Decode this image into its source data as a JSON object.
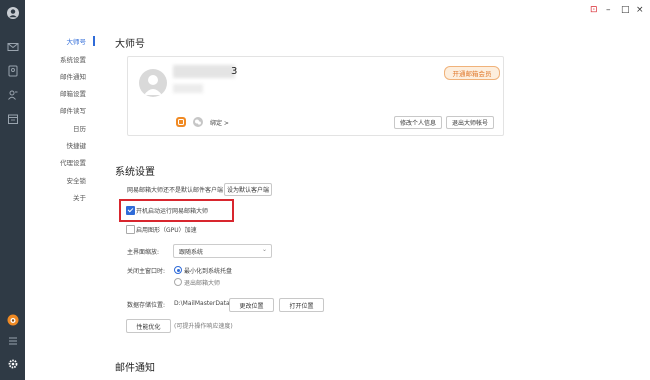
{
  "nav": {
    "items": [
      "大师号",
      "系统设置",
      "邮件通知",
      "邮箱设置",
      "邮件读写",
      "日历",
      "快捷键",
      "代理设置",
      "安全锁",
      "关于"
    ],
    "active_index": 0
  },
  "window_controls": {
    "pin": "⊡",
    "minimize": "–",
    "maximize": "□",
    "close": "×"
  },
  "master": {
    "title": "大师号",
    "username_visible": "3",
    "vip_button": "开通邮箱会员",
    "bind_label": "绑定 >",
    "edit_profile": "修改个人信息",
    "logout_master": "退出大师帐号"
  },
  "system": {
    "title": "系统设置",
    "default_client_text": "网易邮箱大师还不是默认邮件客户端",
    "set_default_button": "设为默认客户端",
    "autostart_label": "开机启动运行网易邮箱大师",
    "autostart_checked": true,
    "gpu_label": "启用图形（GPU）加速",
    "gpu_checked": false,
    "theme_label": "主界面缩放:",
    "theme_value": "跟随系统",
    "close_label": "关闭主窗口时:",
    "close_options": [
      "最小化到系统托盘",
      "退出邮箱大师"
    ],
    "close_selected": 0,
    "storage_label": "数据存储位置:",
    "storage_path": "D:\\MailMasterData",
    "change_location": "更改位置",
    "open_location": "打开位置",
    "optimize_button": "性能优化",
    "optimize_hint": "(可提升操作响应速度)"
  },
  "mail_notify": {
    "title": "邮件通知"
  },
  "colors": {
    "sidebar": "#2f3a45",
    "accent": "#2f6bd8",
    "highlight": "#d8262e",
    "vip": "#e07a2e"
  },
  "icons": {
    "sidebar": [
      "avatar-icon",
      "mail-icon",
      "contacts-icon",
      "people-icon",
      "calendar-icon",
      "app-badge-icon",
      "menu-icon",
      "settings-icon"
    ]
  }
}
